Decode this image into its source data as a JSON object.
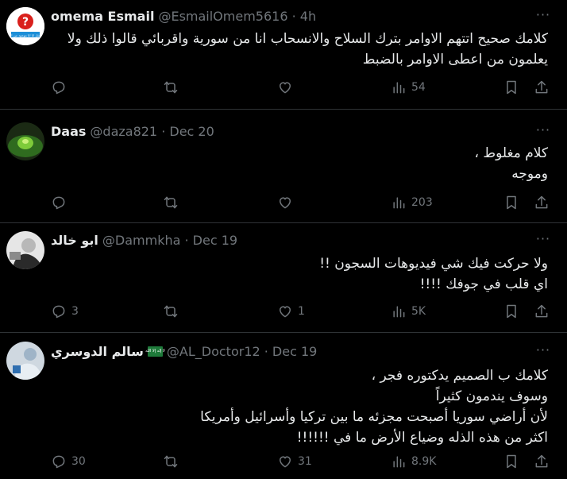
{
  "tweets": [
    {
      "name": "omema Esmail",
      "handle": "@EsmailOmem5616 · 4h",
      "lines": [
        "كلامك صحيح اتتهم الاوامر بترك السلاح والانسحاب انا من سورية واقربائي قالوا ذلك ولا",
        "يعلمون من اعطى الاوامر بالضبط"
      ],
      "replies": "",
      "retweets": "",
      "likes": "",
      "views": "54"
    },
    {
      "name": "Daas",
      "handle": "@daza821 · Dec 20",
      "lines": [
        "كلام مغلوط ،",
        "وموجه"
      ],
      "replies": "",
      "retweets": "",
      "likes": "",
      "views": "203"
    },
    {
      "name": "ابو خالد",
      "handle": "@Dammkha · Dec 19",
      "lines": [
        "ولا حركت  فيك شي فيديوهات السجون !!",
        "اي قلب في جوفك !!!!"
      ],
      "replies": "3",
      "retweets": "",
      "likes": "1",
      "views": "5K"
    },
    {
      "name": "سالم الدوسري",
      "flag_text": "لا إله إلا الله",
      "handle": "@AL_Doctor12 · Dec 19",
      "lines": [
        "كلامك ب الصميم يدكتوره فجر ،",
        "وسوف يندمون كثيراً",
        "لأن أراضي سوريا أصبحت مجزئه ما بين تركيا وأسرائيل وأمريكا",
        "اكثر من هذه الذله وضياع الأرض ما في !!!!!!"
      ],
      "replies": "30",
      "retweets": "",
      "likes": "31",
      "views": "8.9K"
    }
  ],
  "avatar_text": "أمثل انا انا موجود من انا",
  "icons": {
    "reply": "reply-icon",
    "retweet": "retweet-icon",
    "like": "like-icon",
    "views": "views-icon",
    "bookmark": "bookmark-icon",
    "share": "share-icon",
    "more": "more-icon"
  },
  "colors": {
    "background": "#000000",
    "text": "#e7e9ea",
    "muted": "#71767b",
    "divider": "#2f3336"
  }
}
